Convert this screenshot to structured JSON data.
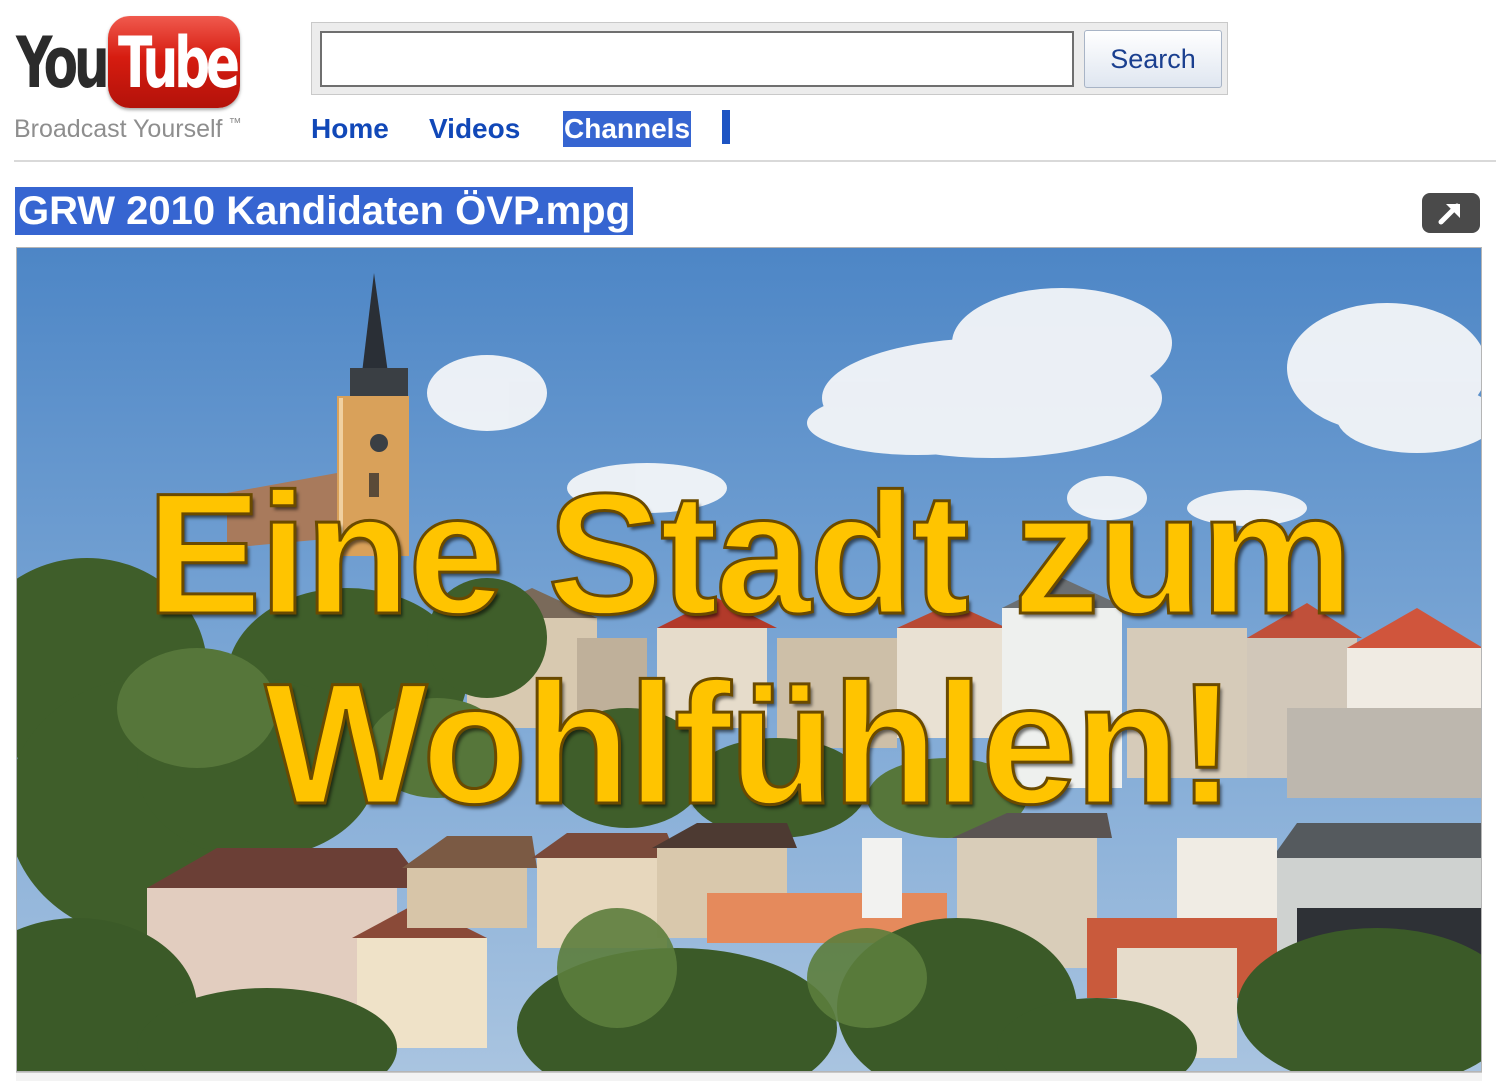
{
  "logo": {
    "you": "You",
    "tube": "Tube",
    "tagline": "Broadcast Yourself",
    "trademark": "™"
  },
  "search": {
    "value": "",
    "button_label": "Search"
  },
  "nav": {
    "items": [
      {
        "label": "Home",
        "selected": false
      },
      {
        "label": "Videos",
        "selected": false
      },
      {
        "label": "Channels",
        "selected": true
      }
    ]
  },
  "video": {
    "title": "GRW 2010 Kandidaten ÖVP.mpg",
    "expand_icon": "expand-arrow-icon",
    "overlay_line_1": "Eine Stadt zum",
    "overlay_line_2": "Wohlfühlen!",
    "overlay_color": "#ffc400"
  },
  "colors": {
    "link": "#1148b8",
    "selection": "#3665d1",
    "logo_red": "#d61c10"
  }
}
